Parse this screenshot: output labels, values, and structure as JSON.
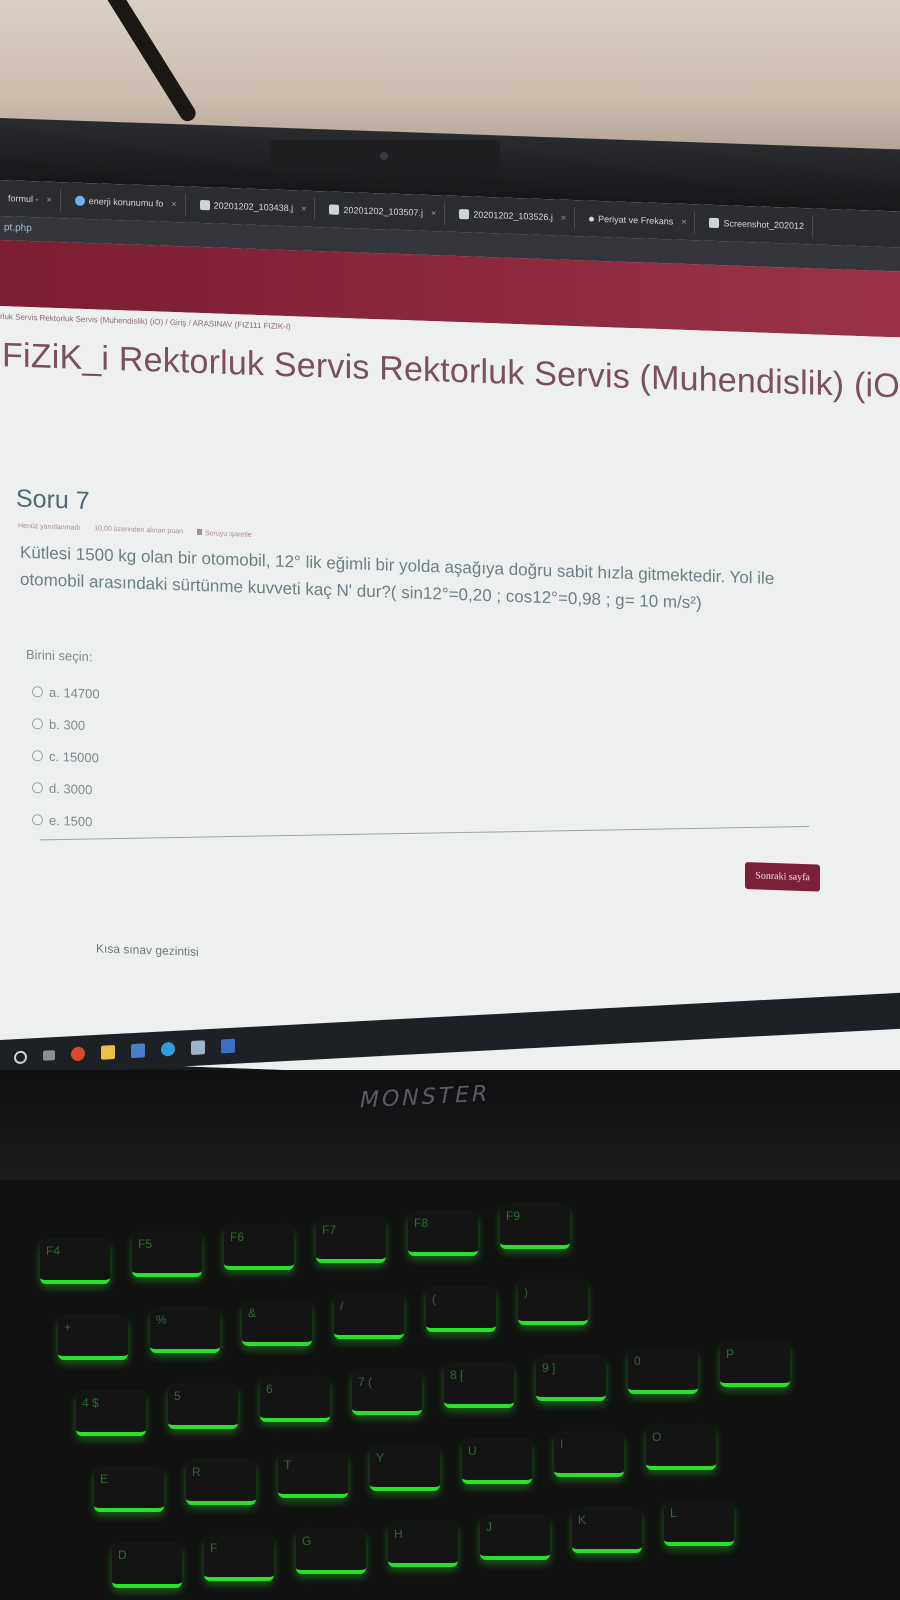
{
  "browser": {
    "tabs": [
      {
        "label": "formul - ",
        "icon": "document-icon"
      },
      {
        "label": "enerji korunumu fo",
        "icon": "globe-icon"
      },
      {
        "label": "20201202_103438.j",
        "icon": "document-icon"
      },
      {
        "label": "20201202_103507.j",
        "icon": "document-icon"
      },
      {
        "label": "20201202_103526.j",
        "icon": "document-icon"
      },
      {
        "label": "Periyat ve Frekans",
        "icon": "dot-icon"
      },
      {
        "label": "Screenshot_202012",
        "icon": "document-icon"
      }
    ],
    "url": "pt.php"
  },
  "page": {
    "breadcrumb": "rluk Servis Rektorluk Servis (Muhendislik) (iO) / Giriş / ARASINAV (FIZ111 FIZIK-I)",
    "course_title": "FiZiK_i Rektorluk Servis Rektorluk Servis (Muhendislik) (iO",
    "question": {
      "heading": "Soru 7",
      "status": "Henüz yanıtlanmadı",
      "points": "10,00 üzerinden alınan puan",
      "flag_label": "Soruyu işaretle",
      "text": "Kütlesi 1500 kg olan bir otomobil, 12° lik eğimli bir yolda aşağıya doğru sabit hızla gitmektedir. Yol ile otomobil arasındaki sürtünme kuvveti kaç N' dur?( sin12°=0,20 ; cos12°=0,98  ; g= 10 m/s²)",
      "choose_label": "Birini seçin:",
      "options": [
        "a. 14700",
        "b. 300",
        "c. 15000",
        "d. 3000",
        "e. 1500"
      ]
    },
    "next_button": "Sonraki sayfa",
    "quiz_navigation": "Kısa sınav gezintisi"
  },
  "laptop_brand": "MONSTER",
  "keyboard_keys": [
    "F4",
    "F5",
    "F6",
    "F7",
    "F8",
    "F9",
    "+",
    "%",
    "&",
    "/",
    "(",
    ")",
    "4 $",
    "5",
    "6",
    "7 (",
    "8 [",
    "9 ]",
    "0",
    "P",
    "E",
    "R",
    "T",
    "Y",
    "U",
    "I",
    "O",
    "D",
    "F",
    "G",
    "H",
    "J",
    "K",
    "L"
  ],
  "colors": {
    "banner": "#8e2a40",
    "title": "#7a4f60",
    "button": "#7b2038",
    "keyboard_backlight": "#2be02b"
  }
}
